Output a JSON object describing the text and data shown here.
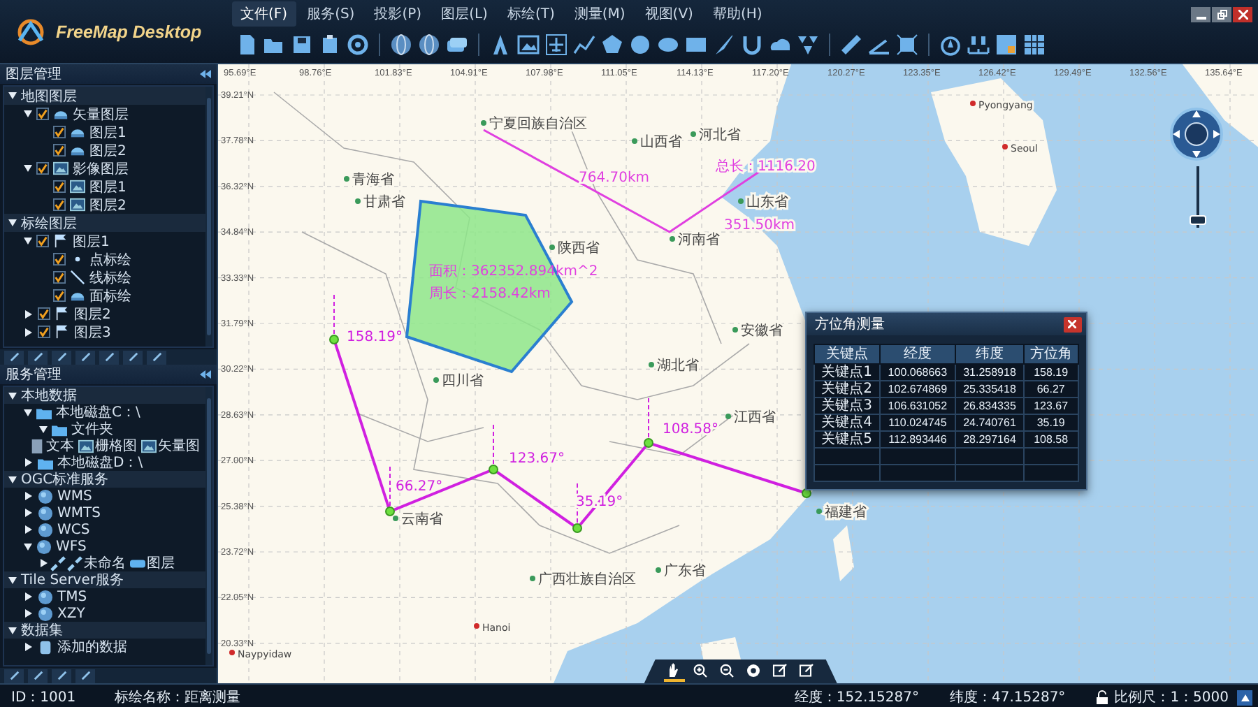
{
  "app": {
    "title": "FreeMap Desktop"
  },
  "menu": [
    {
      "label": "文件(F)",
      "selected": true
    },
    {
      "label": "服务(S)",
      "selected": false
    },
    {
      "label": "投影(P)",
      "selected": false
    },
    {
      "label": "图层(L)",
      "selected": false
    },
    {
      "label": "标绘(T)",
      "selected": false
    },
    {
      "label": "测量(M)",
      "selected": false
    },
    {
      "label": "视图(V)",
      "selected": false
    },
    {
      "label": "帮助(H)",
      "selected": false
    }
  ],
  "layer_panel": {
    "title": "图层管理",
    "tree": [
      {
        "label": "地图图层",
        "expanded": true,
        "children": [
          {
            "label": "矢量图层",
            "kind": "vector",
            "expanded": true,
            "checked": true,
            "children": [
              {
                "label": "图层1",
                "kind": "vector",
                "checked": true
              },
              {
                "label": "图层2",
                "kind": "vector",
                "checked": true
              }
            ]
          },
          {
            "label": "影像图层",
            "kind": "image",
            "expanded": true,
            "checked": true,
            "children": [
              {
                "label": "图层1",
                "kind": "image",
                "checked": true
              },
              {
                "label": "图层2",
                "kind": "image",
                "checked": true
              }
            ]
          }
        ]
      },
      {
        "label": "标绘图层",
        "expanded": true,
        "children": [
          {
            "label": "图层1",
            "kind": "flag",
            "expanded": true,
            "checked": true,
            "children": [
              {
                "label": "点标绘",
                "kind": "point",
                "checked": true
              },
              {
                "label": "线标绘",
                "kind": "line",
                "checked": true
              },
              {
                "label": "面标绘",
                "kind": "polygon",
                "checked": true
              }
            ]
          },
          {
            "label": "图层2",
            "kind": "flag",
            "expanded": false,
            "checked": true
          },
          {
            "label": "图层3",
            "kind": "flag",
            "expanded": false,
            "checked": true
          }
        ]
      }
    ]
  },
  "service_panel": {
    "title": "服务管理",
    "tree": [
      {
        "label": "本地数据",
        "expanded": true,
        "children": [
          {
            "label": "本地磁盘C：\\",
            "kind": "folder",
            "expanded": true,
            "children": [
              {
                "label": "文件夹",
                "kind": "folder",
                "expanded": true,
                "children": [
                  {
                    "entries": [
                      {
                        "label": "文本",
                        "kind": "file"
                      },
                      {
                        "label": "栅格图",
                        "kind": "raster"
                      },
                      {
                        "label": "矢量图",
                        "kind": "vectorimg"
                      }
                    ]
                  }
                ]
              }
            ]
          },
          {
            "label": "本地磁盘D：\\",
            "kind": "folder",
            "expanded": false
          }
        ]
      },
      {
        "label": "OGC标准服务",
        "expanded": true,
        "children": [
          {
            "label": "WMS",
            "kind": "globe",
            "expanded": false
          },
          {
            "label": "WMTS",
            "kind": "globe",
            "expanded": false
          },
          {
            "label": "WCS",
            "kind": "globe",
            "expanded": false
          },
          {
            "label": "WFS",
            "kind": "globe",
            "expanded": true,
            "children": [
              {
                "expanded": false,
                "entries": [
                  {
                    "label": "未命名",
                    "kind": "link"
                  },
                  {
                    "label": "图层",
                    "kind": "layer"
                  }
                ]
              }
            ]
          }
        ]
      },
      {
        "label": "Tile Server服务",
        "expanded": true,
        "children": [
          {
            "label": "TMS",
            "kind": "globe",
            "expanded": false
          },
          {
            "label": "XZY",
            "kind": "globe",
            "expanded": false
          }
        ]
      },
      {
        "label": "数据集",
        "expanded": true,
        "children": [
          {
            "label": "添加的数据",
            "kind": "database",
            "expanded": false
          }
        ]
      }
    ]
  },
  "map": {
    "lon_ticks": [
      "95.69°E",
      "98.76°E",
      "101.83°E",
      "104.91°E",
      "107.98°E",
      "111.05°E",
      "114.13°E",
      "117.20°E",
      "120.27°E",
      "123.35°E",
      "126.42°E",
      "129.49°E",
      "132.56°E",
      "135.64°E"
    ],
    "lat_ticks": [
      "39.21°N",
      "37.78°N",
      "36.32°N",
      "34.84°N",
      "33.33°N",
      "31.79°N",
      "30.22°N",
      "28.63°N",
      "27.00°N",
      "25.38°N",
      "23.72°N",
      "22.05°N",
      "20.33°N"
    ],
    "places": [
      {
        "label": "宁夏回族自治区",
        "kind": "province"
      },
      {
        "label": "山西省",
        "kind": "province"
      },
      {
        "label": "河北省",
        "kind": "province"
      },
      {
        "label": "青海省",
        "kind": "province"
      },
      {
        "label": "甘肃省",
        "kind": "province"
      },
      {
        "label": "陕西省",
        "kind": "province"
      },
      {
        "label": "河南省",
        "kind": "province"
      },
      {
        "label": "山东省",
        "kind": "province"
      },
      {
        "label": "四川省",
        "kind": "province"
      },
      {
        "label": "湖北省",
        "kind": "province"
      },
      {
        "label": "安徽省",
        "kind": "province"
      },
      {
        "label": "江西省",
        "kind": "province"
      },
      {
        "label": "云南省",
        "kind": "province"
      },
      {
        "label": "广西壮族自治区",
        "kind": "province"
      },
      {
        "label": "广东省",
        "kind": "province"
      },
      {
        "label": "福建省",
        "kind": "province"
      },
      {
        "label": "Pyongyang",
        "kind": "city"
      },
      {
        "label": "Seoul",
        "kind": "city"
      },
      {
        "label": "Hanoi",
        "kind": "city"
      },
      {
        "label": "Naypyidaw",
        "kind": "city"
      }
    ],
    "distance": {
      "segments": [
        "764.70km",
        "351.50km"
      ],
      "total": "总长：1116.20"
    },
    "area": {
      "area": "面积：362352.894km^2",
      "perimeter": "周长：2158.42km"
    },
    "angles": [
      "158.19°",
      "66.27°",
      "123.67°",
      "35.19°",
      "108.58°"
    ]
  },
  "azimuth_dialog": {
    "title": "方位角测量",
    "columns": [
      "关键点",
      "经度",
      "纬度",
      "方位角"
    ],
    "rows": [
      [
        "关键点1",
        "100.068663",
        "31.258918",
        "158.19"
      ],
      [
        "关键点2",
        "102.674869",
        "25.335418",
        "66.27"
      ],
      [
        "关键点3",
        "106.631052",
        "26.834335",
        "123.67"
      ],
      [
        "关键点4",
        "110.024745",
        "24.740761",
        "35.19"
      ],
      [
        "关键点5",
        "112.893446",
        "28.297164",
        "108.58"
      ]
    ]
  },
  "map_tools": [
    {
      "selected": true
    },
    {
      "selected": false
    },
    {
      "selected": false
    },
    {
      "selected": false
    },
    {
      "selected": false
    },
    {
      "selected": false
    }
  ],
  "zoom_slider": {
    "level": 0.05
  },
  "status_bar": {
    "id": "ID：1001",
    "plot_name": "标绘名称：距离测量",
    "longitude": "经度：152.15287°",
    "latitude": "纬度：47.15287°",
    "scale": "比例尺：1：5000"
  }
}
